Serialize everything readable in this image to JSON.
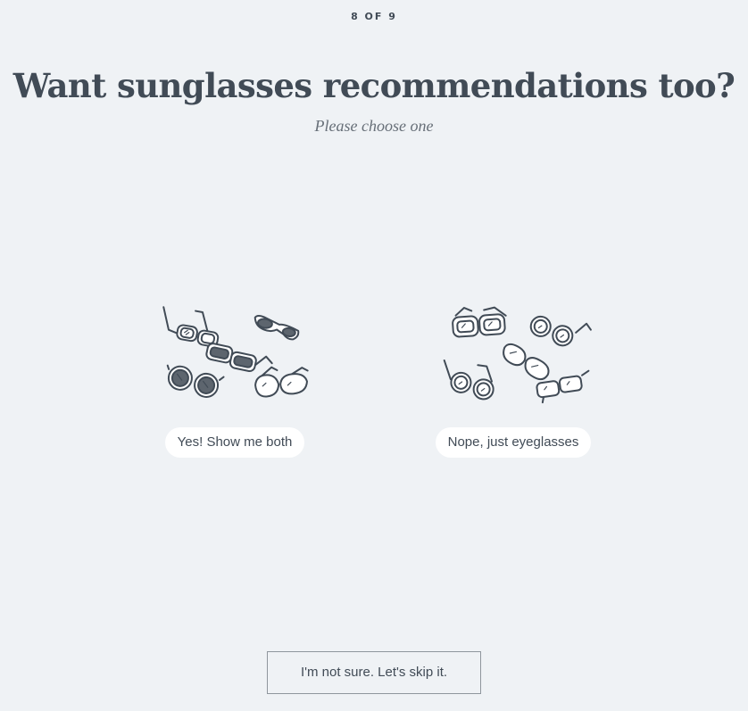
{
  "progress": {
    "label": "8 OF 9",
    "current": 8,
    "total": 9
  },
  "heading": {
    "title": "Want sunglasses recommendations too?",
    "subtitle": "Please choose one"
  },
  "options": [
    {
      "label": "Yes! Show me both",
      "icon": "sunglasses-and-eyeglasses-illustration"
    },
    {
      "label": "Nope, just eyeglasses",
      "icon": "eyeglasses-illustration"
    }
  ],
  "skip": {
    "label": "I'm not sure. Let's skip it."
  },
  "colors": {
    "background": "#eff2f5",
    "text": "#414b56",
    "pill": "#ffffff",
    "lens_dark": "#5d656e"
  }
}
